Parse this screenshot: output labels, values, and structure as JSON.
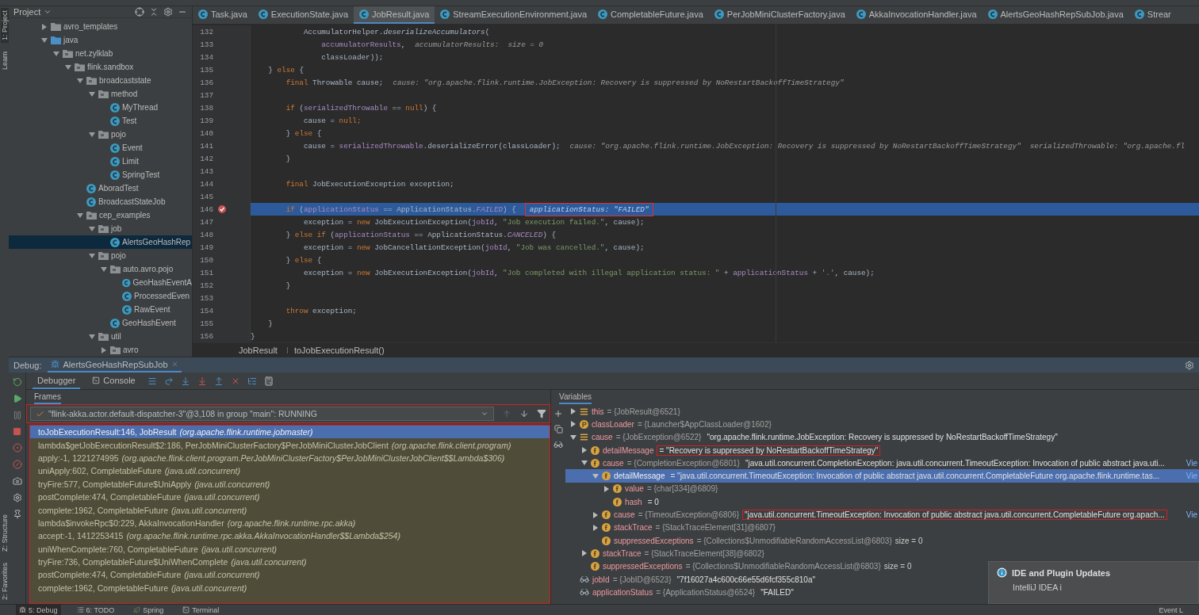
{
  "side_tools": {
    "top": [
      {
        "label": "1: Project",
        "selected": true
      },
      {
        "label": "Learn",
        "selected": false
      }
    ],
    "bottom": [
      {
        "label": "Z: Structure",
        "selected": false
      },
      {
        "label": "2: Favorites",
        "selected": false
      }
    ]
  },
  "project_panel": {
    "title": "Project",
    "tree": [
      {
        "label": "avro_templates",
        "kind": "folder",
        "expanded": false,
        "selected": false
      },
      {
        "label": "java",
        "kind": "source",
        "expanded": true,
        "selected": false,
        "children": [
          {
            "label": "net.zylklab",
            "kind": "package",
            "expanded": true,
            "selected": false,
            "children": [
              {
                "label": "flink.sandbox",
                "kind": "package",
                "expanded": true,
                "selected": false,
                "children": [
                  {
                    "label": "broadcaststate",
                    "kind": "package",
                    "expanded": true,
                    "selected": false,
                    "children": [
                      {
                        "label": "method",
                        "kind": "package",
                        "expanded": true,
                        "selected": false,
                        "children": [
                          {
                            "label": "MyThread",
                            "kind": "class",
                            "selected": false
                          },
                          {
                            "label": "Test",
                            "kind": "class",
                            "selected": false
                          }
                        ]
                      },
                      {
                        "label": "pojo",
                        "kind": "package",
                        "expanded": true,
                        "selected": false,
                        "children": [
                          {
                            "label": "Event",
                            "kind": "class",
                            "selected": false
                          },
                          {
                            "label": "Limit",
                            "kind": "class",
                            "selected": false
                          },
                          {
                            "label": "SpringTest",
                            "kind": "class",
                            "selected": false
                          }
                        ]
                      }
                    ]
                  },
                  {
                    "label": "AboradTest",
                    "kind": "class",
                    "selected": false
                  },
                  {
                    "label": "BroadcastStateJob",
                    "kind": "class",
                    "selected": false
                  },
                  {
                    "label": "cep_examples",
                    "kind": "package",
                    "expanded": true,
                    "selected": false,
                    "children": [
                      {
                        "label": "job",
                        "kind": "package",
                        "expanded": true,
                        "selected": false,
                        "children": [
                          {
                            "label": "AlertsGeoHashRep",
                            "kind": "class",
                            "selected": true
                          }
                        ]
                      },
                      {
                        "label": "pojo",
                        "kind": "package",
                        "expanded": true,
                        "selected": false,
                        "children": [
                          {
                            "label": "auto.avro.pojo",
                            "kind": "package",
                            "expanded": true,
                            "selected": false,
                            "children": [
                              {
                                "label": "GeoHashEventA",
                                "kind": "class",
                                "selected": false
                              },
                              {
                                "label": "ProcessedEven",
                                "kind": "class",
                                "selected": false
                              },
                              {
                                "label": "RawEvent",
                                "kind": "class",
                                "selected": false
                              }
                            ]
                          },
                          {
                            "label": "GeoHashEvent",
                            "kind": "class",
                            "selected": false
                          }
                        ]
                      },
                      {
                        "label": "util",
                        "kind": "package",
                        "expanded": true,
                        "selected": false,
                        "children": [
                          {
                            "label": "avro",
                            "kind": "package",
                            "expanded": false,
                            "selected": false
                          }
                        ]
                      }
                    ]
                  }
                ]
              }
            ]
          }
        ]
      }
    ]
  },
  "editor": {
    "tabs": [
      {
        "label": "Task.java",
        "selected": false
      },
      {
        "label": "ExecutionState.java",
        "selected": false
      },
      {
        "label": "JobResult.java",
        "selected": true
      },
      {
        "label": "StreamExecutionEnvironment.java",
        "selected": false
      },
      {
        "label": "CompletableFuture.java",
        "selected": false
      },
      {
        "label": "PerJobMiniClusterFactory.java",
        "selected": false
      },
      {
        "label": "AkkaInvocationHandler.java",
        "selected": false
      },
      {
        "label": "AlertsGeoHashRepSubJob.java",
        "selected": false
      },
      {
        "label": "Strear",
        "selected": false
      }
    ],
    "lines": [
      {
        "number": "132",
        "current": false,
        "breakpoint": false,
        "tokens": [
          {
            "kind": "plain",
            "text": "            AccumulatorHelper."
          },
          {
            "kind": "method",
            "text": "deserializeAccumulators"
          },
          {
            "kind": "plain",
            "text": "("
          }
        ]
      },
      {
        "number": "133",
        "current": false,
        "breakpoint": false,
        "tokens": [
          {
            "kind": "field",
            "text": "                accumulatorResults"
          },
          {
            "kind": "plain",
            "text": ","
          }
        ],
        "hint": "accumulatorResults:  size = 0"
      },
      {
        "number": "134",
        "current": false,
        "breakpoint": false,
        "tokens": [
          {
            "kind": "plain",
            "text": "                classLoader));"
          }
        ]
      },
      {
        "number": "135",
        "current": false,
        "breakpoint": false,
        "tokens": [
          {
            "kind": "plain",
            "text": "    } "
          },
          {
            "kind": "keyword",
            "text": "else"
          },
          {
            "kind": "plain",
            "text": " {"
          }
        ]
      },
      {
        "number": "136",
        "current": false,
        "breakpoint": false,
        "tokens": [
          {
            "kind": "keyword",
            "text": "        final "
          },
          {
            "kind": "plain",
            "text": "Throwable cause;"
          }
        ],
        "hint": "cause: \"org.apache.flink.runtime.JobException: Recovery is suppressed by NoRestartBackoffTimeStrategy\""
      },
      {
        "number": "137",
        "current": false,
        "breakpoint": false
      },
      {
        "number": "138",
        "current": false,
        "breakpoint": false,
        "tokens": [
          {
            "kind": "keyword",
            "text": "        if "
          },
          {
            "kind": "plain",
            "text": "("
          },
          {
            "kind": "field",
            "text": "serializedThrowable"
          },
          {
            "kind": "plain",
            "text": " == "
          },
          {
            "kind": "keyword",
            "text": "null"
          },
          {
            "kind": "plain",
            "text": ") {"
          }
        ]
      },
      {
        "number": "139",
        "current": false,
        "breakpoint": false,
        "tokens": [
          {
            "kind": "plain",
            "text": "            cause = "
          },
          {
            "kind": "keyword",
            "text": "null;"
          }
        ]
      },
      {
        "number": "140",
        "current": false,
        "breakpoint": false,
        "tokens": [
          {
            "kind": "plain",
            "text": "        } "
          },
          {
            "kind": "keyword",
            "text": "else"
          },
          {
            "kind": "plain",
            "text": " {"
          }
        ]
      },
      {
        "number": "141",
        "current": false,
        "breakpoint": false,
        "tokens": [
          {
            "kind": "plain",
            "text": "            cause = "
          },
          {
            "kind": "field",
            "text": "serializedThrowable"
          },
          {
            "kind": "plain",
            "text": ".deserializeError(classLoader);"
          }
        ],
        "hint": "cause: \"org.apache.flink.runtime.JobException: Recovery is suppressed by NoRestartBackoffTimeStrategy\"  serializedThrowable: \"org.apache.fl"
      },
      {
        "number": "142",
        "current": false,
        "breakpoint": false,
        "tokens": [
          {
            "kind": "plain",
            "text": "        }"
          }
        ]
      },
      {
        "number": "143",
        "current": false,
        "breakpoint": false
      },
      {
        "number": "144",
        "current": false,
        "breakpoint": false,
        "tokens": [
          {
            "kind": "keyword",
            "text": "        final "
          },
          {
            "kind": "plain",
            "text": "JobExecutionException exception;"
          }
        ]
      },
      {
        "number": "145",
        "current": false,
        "breakpoint": false
      },
      {
        "number": "146",
        "current": true,
        "breakpoint": true,
        "tokens": [
          {
            "kind": "keyword",
            "text": "        if "
          },
          {
            "kind": "plain",
            "text": "("
          },
          {
            "kind": "field",
            "text": "applicationStatus"
          },
          {
            "kind": "plain",
            "text": " == ApplicationStatus."
          },
          {
            "kind": "constant",
            "text": "FAILED"
          },
          {
            "kind": "plain",
            "text": ") {"
          }
        ],
        "hint": "applicationStatus: \"FAILED\"",
        "annotated": true
      },
      {
        "number": "147",
        "current": false,
        "breakpoint": false,
        "tokens": [
          {
            "kind": "plain",
            "text": "            exception = "
          },
          {
            "kind": "keyword",
            "text": "new "
          },
          {
            "kind": "plain",
            "text": "JobExecutionException("
          },
          {
            "kind": "field",
            "text": "jobId"
          },
          {
            "kind": "plain",
            "text": ", "
          },
          {
            "kind": "string",
            "text": "\"Job execution failed.\""
          },
          {
            "kind": "plain",
            "text": ", cause);"
          }
        ]
      },
      {
        "number": "148",
        "current": false,
        "breakpoint": false,
        "tokens": [
          {
            "kind": "plain",
            "text": "        } "
          },
          {
            "kind": "keyword",
            "text": "else if "
          },
          {
            "kind": "plain",
            "text": "("
          },
          {
            "kind": "field",
            "text": "applicationStatus"
          },
          {
            "kind": "plain",
            "text": " == ApplicationStatus."
          },
          {
            "kind": "constant",
            "text": "CANCELED"
          },
          {
            "kind": "plain",
            "text": ") {"
          }
        ]
      },
      {
        "number": "149",
        "current": false,
        "breakpoint": false,
        "tokens": [
          {
            "kind": "plain",
            "text": "            exception = "
          },
          {
            "kind": "keyword",
            "text": "new "
          },
          {
            "kind": "plain",
            "text": "JobCancellationException("
          },
          {
            "kind": "field",
            "text": "jobId"
          },
          {
            "kind": "plain",
            "text": ", "
          },
          {
            "kind": "string",
            "text": "\"Job was cancelled.\""
          },
          {
            "kind": "plain",
            "text": ", cause);"
          }
        ]
      },
      {
        "number": "150",
        "current": false,
        "breakpoint": false,
        "tokens": [
          {
            "kind": "plain",
            "text": "        } "
          },
          {
            "kind": "keyword",
            "text": "else"
          },
          {
            "kind": "plain",
            "text": " {"
          }
        ]
      },
      {
        "number": "151",
        "current": false,
        "breakpoint": false,
        "tokens": [
          {
            "kind": "plain",
            "text": "            exception = "
          },
          {
            "kind": "keyword",
            "text": "new "
          },
          {
            "kind": "plain",
            "text": "JobExecutionException("
          },
          {
            "kind": "field",
            "text": "jobId"
          },
          {
            "kind": "plain",
            "text": ", "
          },
          {
            "kind": "string",
            "text": "\"Job completed with illegal application status: \""
          },
          {
            "kind": "plain",
            "text": " + "
          },
          {
            "kind": "field",
            "text": "applicationStatus"
          },
          {
            "kind": "plain",
            "text": " + "
          },
          {
            "kind": "string",
            "text": "'.'"
          },
          {
            "kind": "plain",
            "text": ", cause);"
          }
        ]
      },
      {
        "number": "152",
        "current": false,
        "breakpoint": false,
        "tokens": [
          {
            "kind": "plain",
            "text": "        }"
          }
        ]
      },
      {
        "number": "153",
        "current": false,
        "breakpoint": false
      },
      {
        "number": "154",
        "current": false,
        "breakpoint": false,
        "tokens": [
          {
            "kind": "keyword",
            "text": "        throw "
          },
          {
            "kind": "plain",
            "text": "exception;"
          }
        ]
      },
      {
        "number": "155",
        "current": false,
        "breakpoint": false,
        "tokens": [
          {
            "kind": "plain",
            "text": "    }"
          }
        ]
      },
      {
        "number": "156",
        "current": false,
        "breakpoint": false,
        "tokens": [
          {
            "kind": "plain",
            "text": "}"
          }
        ]
      }
    ],
    "breadcrumb": [
      "JobResult",
      "toJobExecutionResult()"
    ]
  },
  "debug": {
    "label": "Debug:",
    "session": "AlertsGeoHashRepSubJob",
    "tabs": [
      {
        "label": "Debugger",
        "selected": true
      },
      {
        "label": "Console",
        "selected": false
      }
    ],
    "frames_title": "Frames",
    "thread": "\"flink-akka.actor.default-dispatcher-3\"@3,108 in group \"main\": RUNNING",
    "thread_annotated": true,
    "frames_annotated": true,
    "frames": [
      {
        "method": "toJobExecutionResult:146, JobResult",
        "package": "(org.apache.flink.runtime.jobmaster)",
        "selected": true
      },
      {
        "method": "lambda$getJobExecutionResult$2:186, PerJobMiniClusterFactory$PerJobMiniClusterJobClient",
        "package": "(org.apache.flink.client.program)",
        "selected": false
      },
      {
        "method": "apply:-1, 1221274995",
        "package": "(org.apache.flink.client.program.PerJobMiniClusterFactory$PerJobMiniClusterJobClient$$Lambda$306)",
        "selected": false
      },
      {
        "method": "uniApply:602, CompletableFuture",
        "package": "(java.util.concurrent)",
        "selected": false
      },
      {
        "method": "tryFire:577, CompletableFuture$UniApply",
        "package": "(java.util.concurrent)",
        "selected": false
      },
      {
        "method": "postComplete:474, CompletableFuture",
        "package": "(java.util.concurrent)",
        "selected": false
      },
      {
        "method": "complete:1962, CompletableFuture",
        "package": "(java.util.concurrent)",
        "selected": false
      },
      {
        "method": "lambda$invokeRpc$0:229, AkkaInvocationHandler",
        "package": "(org.apache.flink.runtime.rpc.akka)",
        "selected": false
      },
      {
        "method": "accept:-1, 1412253415",
        "package": "(org.apache.flink.runtime.rpc.akka.AkkaInvocationHandler$$Lambda$254)",
        "selected": false
      },
      {
        "method": "uniWhenComplete:760, CompletableFuture",
        "package": "(java.util.concurrent)",
        "selected": false
      },
      {
        "method": "tryFire:736, CompletableFuture$UniWhenComplete",
        "package": "(java.util.concurrent)",
        "selected": false
      },
      {
        "method": "postComplete:474, CompletableFuture",
        "package": "(java.util.concurrent)",
        "selected": false
      },
      {
        "method": "complete:1962, CompletableFuture",
        "package": "(java.util.concurrent)",
        "selected": false
      }
    ],
    "variables_title": "Variables",
    "variables": [
      {
        "kind": "object",
        "name": "this",
        "ref": "= {JobResult@6521}",
        "expanded": false,
        "selected": false
      },
      {
        "kind": "parameter",
        "name": "classLoader",
        "ref": "= {Launcher$AppClassLoader@1602}",
        "expanded": false,
        "selected": false
      },
      {
        "kind": "object",
        "name": "cause",
        "ref": "= {JobException@6522}",
        "value": "\"org.apache.flink.runtime.JobException: Recovery is suppressed by NoRestartBackoffTimeStrategy\"",
        "expanded": true,
        "selected": false,
        "children": [
          {
            "kind": "field",
            "name": "detailMessage",
            "value": "= \"Recovery is suppressed by NoRestartBackoffTimeStrategy\"",
            "annotated": true,
            "expanded": false,
            "selected": false
          },
          {
            "kind": "field",
            "name": "cause",
            "ref": "= {CompletionException@6801}",
            "value": "\"java.util.concurrent.CompletionException: java.util.concurrent.TimeoutException: Invocation of public abstract java.uti...",
            "link": "Vie",
            "expanded": true,
            "selected": false,
            "children": [
              {
                "kind": "field",
                "name": "detailMessage",
                "value": "= \"java.util.concurrent.TimeoutException: Invocation of public abstract java.util.concurrent.CompletableFuture org.apache.flink.runtime.tas...",
                "link": "Vie",
                "expanded": true,
                "selected": true,
                "children": [
                  {
                    "kind": "field",
                    "name": "value",
                    "ref": "= {char[334]@6809}",
                    "expanded": false,
                    "selected": false
                  },
                  {
                    "kind": "field",
                    "name": "hash",
                    "value": "= 0",
                    "selected": false
                  }
                ]
              },
              {
                "kind": "field",
                "name": "cause",
                "ref": "= {TimeoutException@6806}",
                "value": "\"java.util.concurrent.TimeoutException: Invocation of public abstract java.util.concurrent.CompletableFuture org.apach...",
                "link": "Vie",
                "annotated": true,
                "expanded": false,
                "selected": false
              },
              {
                "kind": "field",
                "name": "stackTrace",
                "ref": "= {StackTraceElement[31]@6807}",
                "expanded": false,
                "selected": false
              },
              {
                "kind": "field",
                "name": "suppressedExceptions",
                "ref": "= {Collections$UnmodifiableRandomAccessList@6803}",
                "extra": "size = 0",
                "selected": false
              }
            ]
          },
          {
            "kind": "field",
            "name": "stackTrace",
            "ref": "= {StackTraceElement[38]@6802}",
            "expanded": false,
            "selected": false
          },
          {
            "kind": "field",
            "name": "suppressedExceptions",
            "ref": "= {Collections$UnmodifiableRandomAccessList@6803}",
            "extra": "size = 0",
            "selected": false
          }
        ]
      },
      {
        "kind": "watch",
        "name": "jobId",
        "ref": "= {JobID@6523}",
        "value": "\"7f16027a4c600c66e55d6fcf355c810a\"",
        "selected": false
      },
      {
        "kind": "watch",
        "name": "applicationStatus",
        "ref": "= {ApplicationStatus@6524}",
        "value": "\"FAILED\"",
        "selected": false
      }
    ]
  },
  "notification": {
    "title": "IDE and Plugin Updates",
    "text": "IntelliJ IDEA i"
  },
  "status_bar": {
    "tabs": [
      {
        "label": "5: Debug",
        "selected": true
      },
      {
        "label": "6: TODO",
        "selected": false
      },
      {
        "label": "Spring",
        "selected": false
      },
      {
        "label": "Terminal",
        "selected": false
      }
    ],
    "right": "Event L"
  }
}
